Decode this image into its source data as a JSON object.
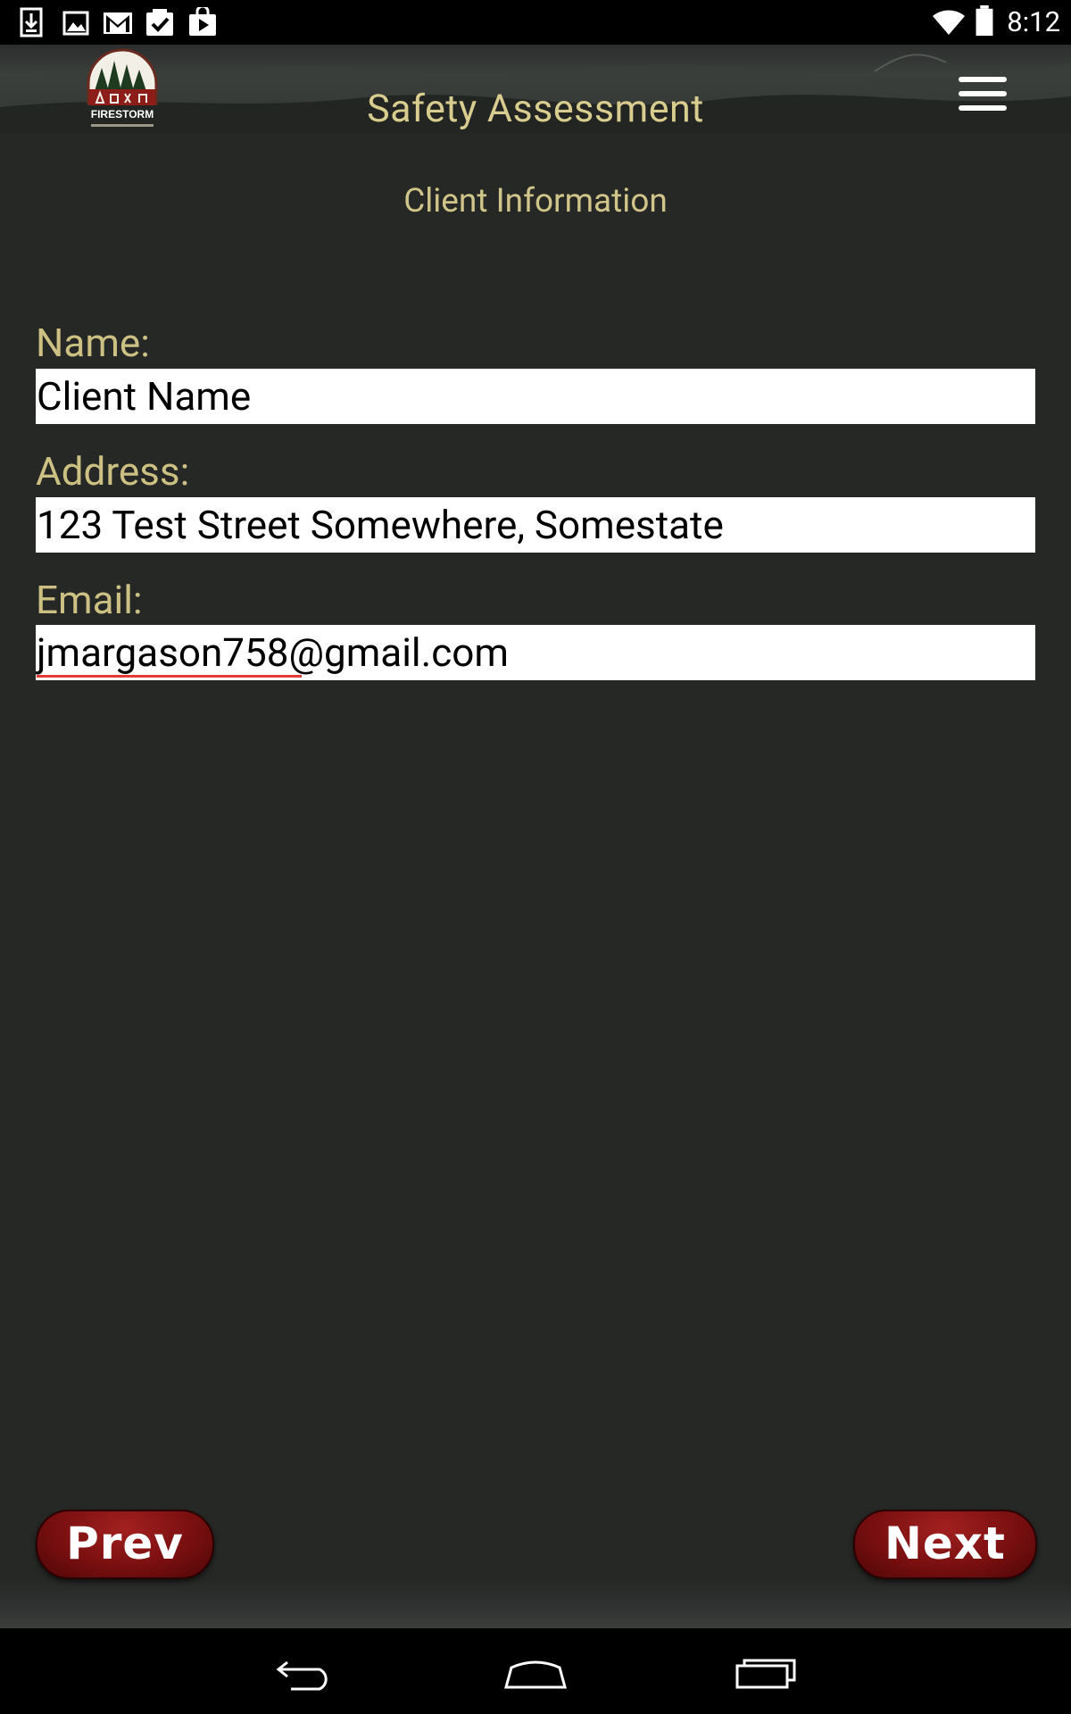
{
  "status_bar": {
    "time": "8:12",
    "left_icons": [
      "download-icon",
      "image-icon",
      "gmail-icon",
      "tasks-check-icon",
      "play-store-icon"
    ],
    "right_icons": [
      "wifi-icon",
      "battery-icon"
    ]
  },
  "header": {
    "logo_text": "FIRESTORM",
    "title": "Safety Assessment",
    "menu_icon": "hamburger-menu-icon"
  },
  "form": {
    "section_title": "Client Information",
    "name": {
      "label": "Name:",
      "value": "Client Name"
    },
    "address": {
      "label": "Address:",
      "value": "123 Test Street Somewhere, Somestate"
    },
    "email": {
      "label": "Email:",
      "value": "jmargason758@gmail.com"
    }
  },
  "nav": {
    "prev_label": "Prev",
    "next_label": "Next"
  },
  "system_nav": [
    "back-icon",
    "home-icon",
    "recent-apps-icon"
  ],
  "colors": {
    "background": "#262826",
    "label_gold": "#cdc083",
    "button_red": "#7a0f10",
    "input_bg": "#ffffff"
  }
}
